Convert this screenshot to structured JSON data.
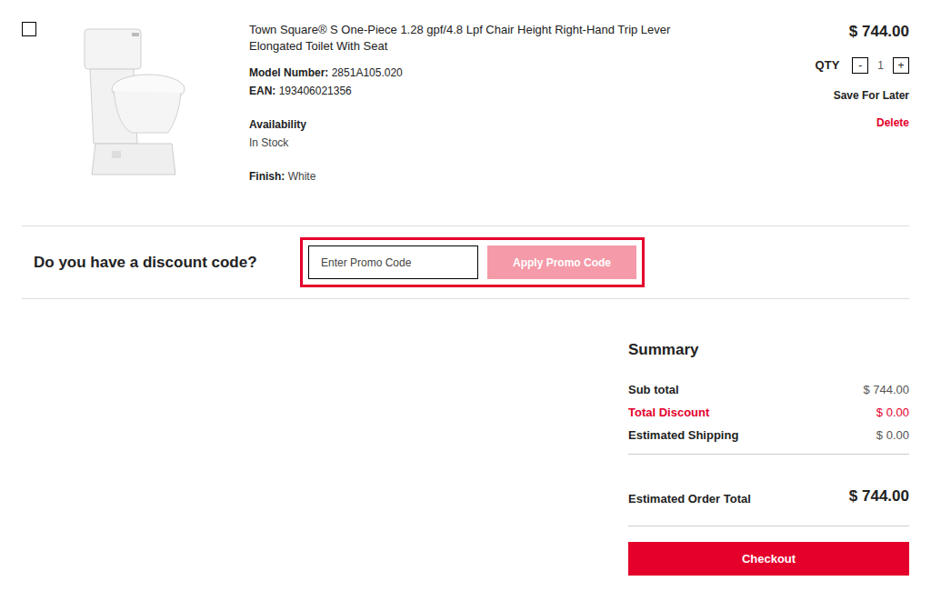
{
  "cart_item": {
    "selected": false,
    "title": "Town Square® S One-Piece 1.28 gpf/4.8 Lpf Chair Height Right-Hand Trip Lever Elongated Toilet With Seat",
    "model_label": "Model Number:",
    "model_value": "2851A105.020",
    "ean_label": "EAN:",
    "ean_value": "193406021356",
    "availability_label": "Availability",
    "availability_value": "In Stock",
    "finish_label": "Finish:",
    "finish_value": "White",
    "price": "$ 744.00",
    "qty_label": "QTY",
    "qty_decrease": "-",
    "qty_value": "1",
    "qty_increase": "+",
    "save_for_later": "Save For Later",
    "delete": "Delete"
  },
  "discount": {
    "prompt": "Do you have a discount code?",
    "placeholder": "Enter Promo Code",
    "button": "Apply Promo Code",
    "button_disabled": true
  },
  "summary": {
    "title": "Summary",
    "rows": [
      {
        "label": "Sub total",
        "value": "$ 744.00",
        "kind": "normal"
      },
      {
        "label": "Total Discount",
        "value": "$ 0.00",
        "kind": "discount"
      },
      {
        "label": "Estimated Shipping",
        "value": "$ 0.00",
        "kind": "normal"
      }
    ],
    "total_label": "Estimated Order Total",
    "total_value": "$ 744.00",
    "checkout": "Checkout"
  }
}
